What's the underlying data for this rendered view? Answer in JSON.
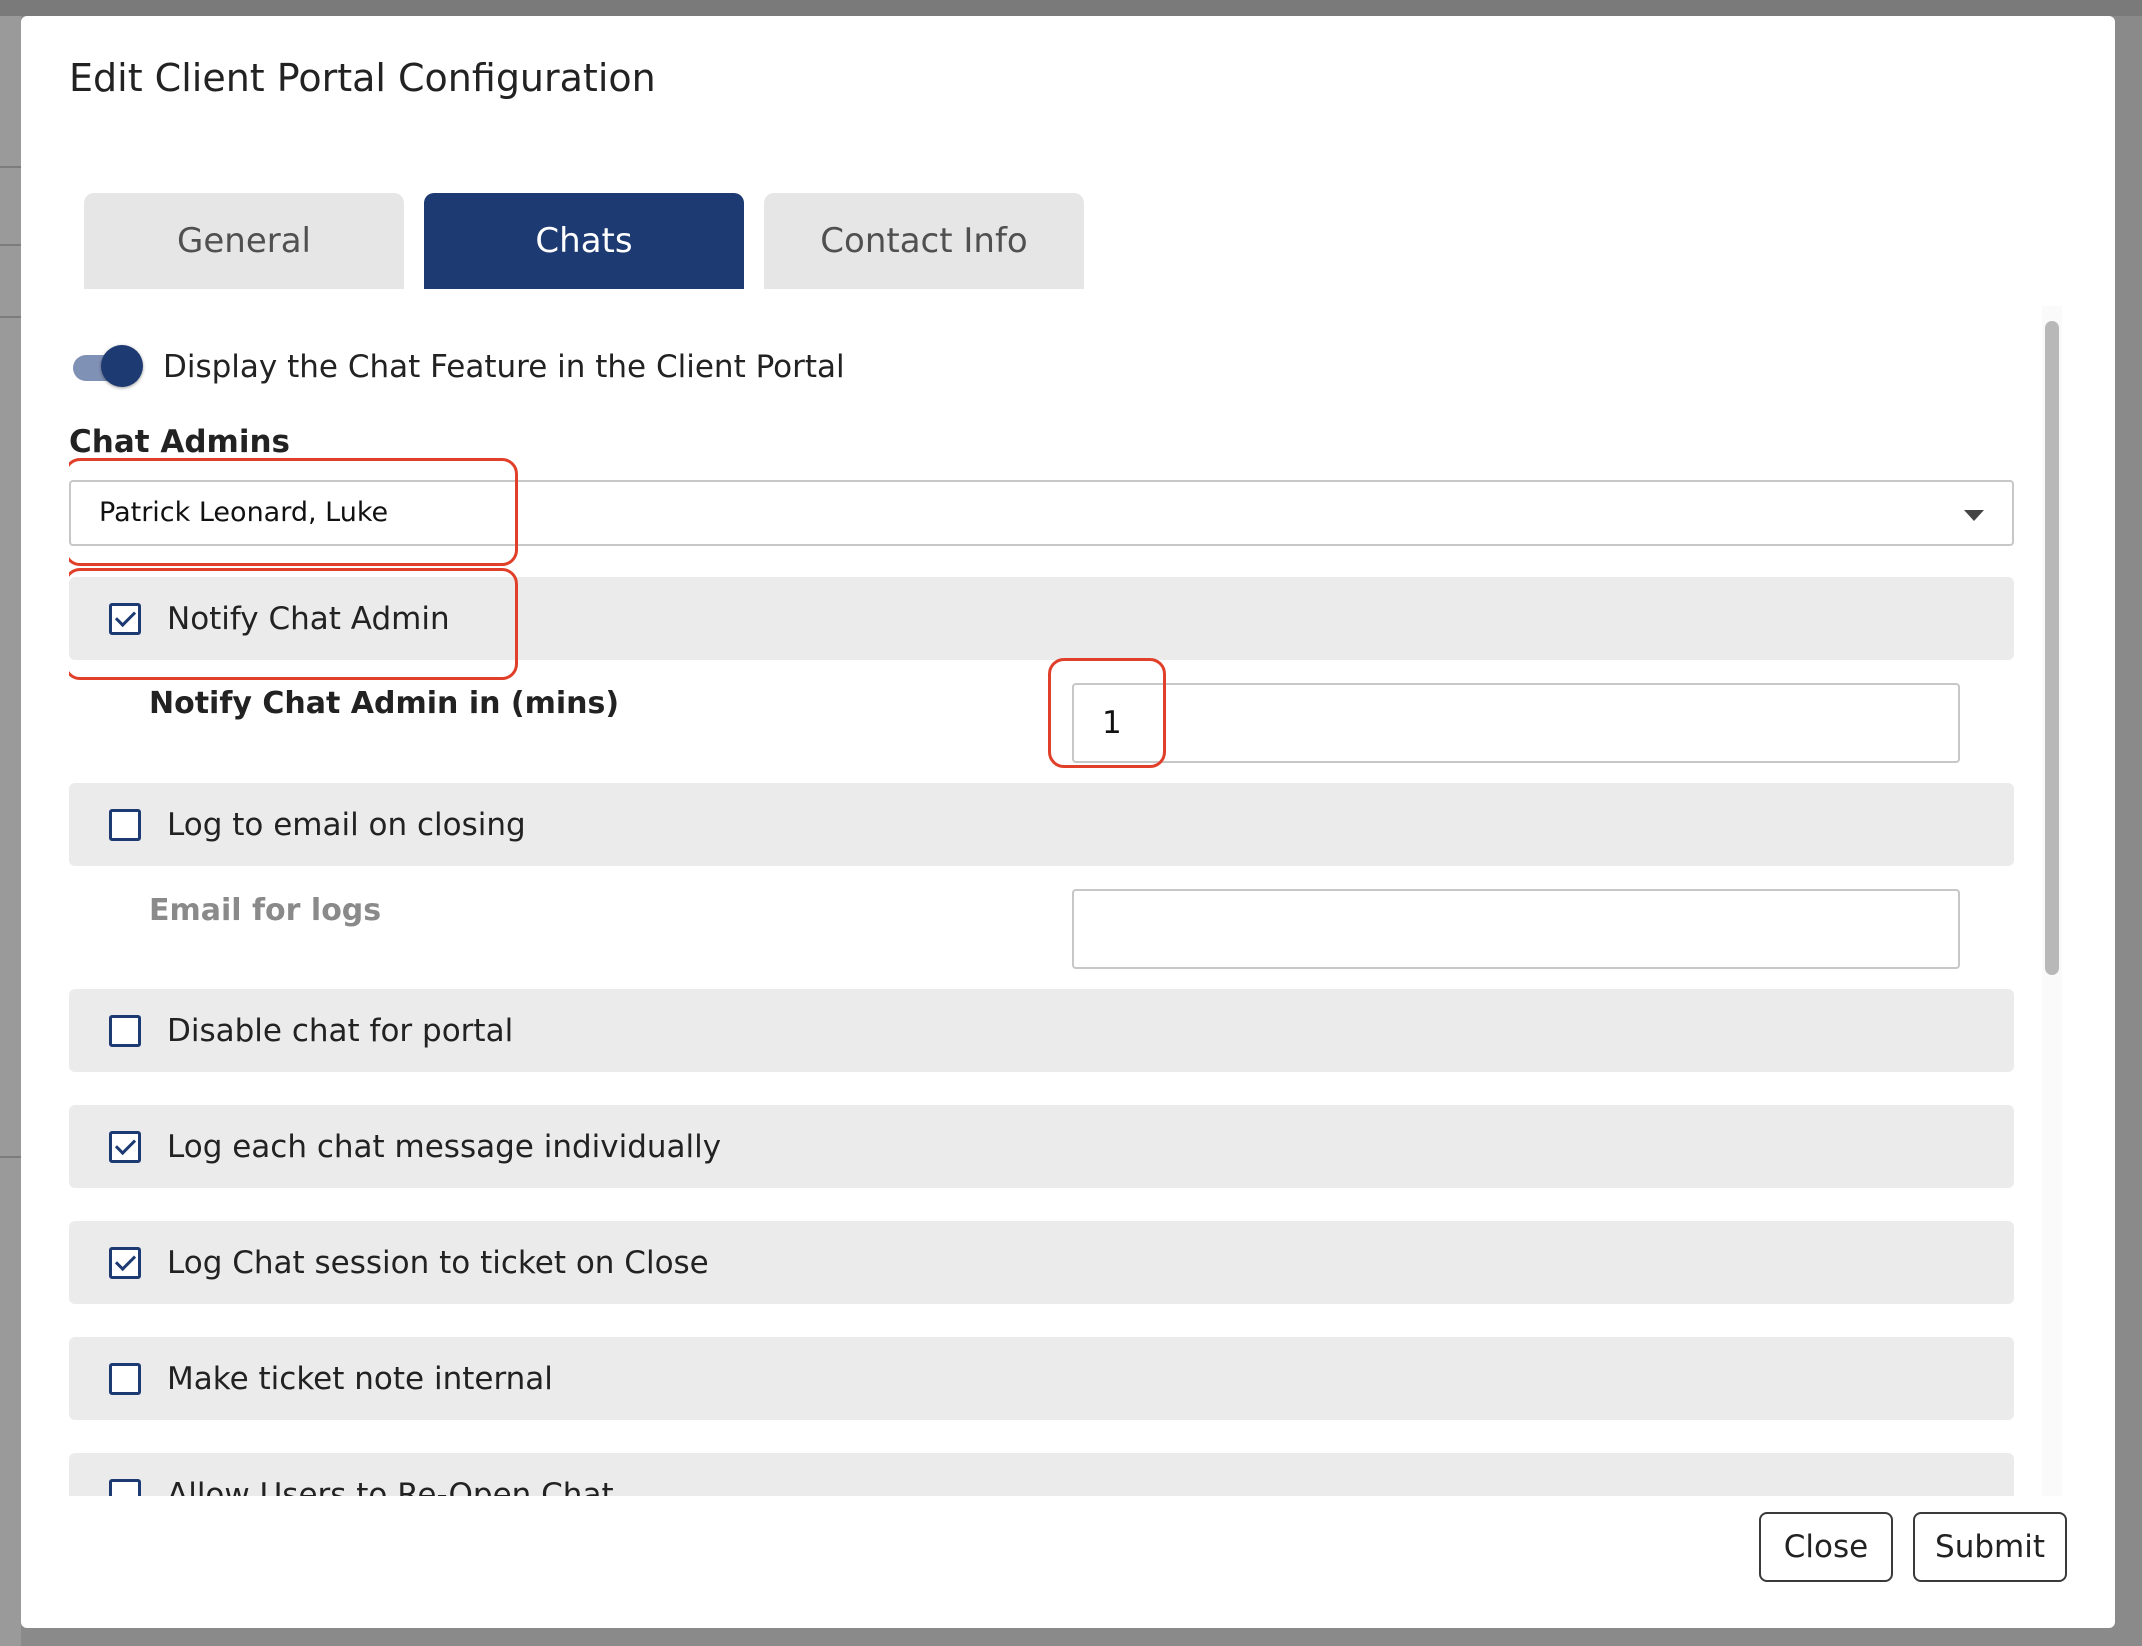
{
  "dialog": {
    "title": "Edit Client Portal Configuration",
    "tabs": [
      {
        "label": "General",
        "active": false
      },
      {
        "label": "Chats",
        "active": true
      },
      {
        "label": "Contact Info",
        "active": false
      }
    ],
    "close_label": "Close",
    "submit_label": "Submit"
  },
  "chats": {
    "display_toggle": {
      "label": "Display the Chat Feature in the Client Portal",
      "on": true
    },
    "chat_admins_label": "Chat Admins",
    "chat_admins_value": "Patrick Leonard, Luke",
    "notify_chat_admin": {
      "label": "Notify Chat Admin",
      "checked": true
    },
    "notify_mins": {
      "label": "Notify Chat Admin in (mins)",
      "value": "1"
    },
    "log_to_email": {
      "label": "Log to email on closing",
      "checked": false
    },
    "email_for_logs": {
      "label": "Email for logs",
      "value": ""
    },
    "disable_chat": {
      "label": "Disable chat for portal",
      "checked": false
    },
    "log_each_message": {
      "label": "Log each chat message individually",
      "checked": true
    },
    "log_session_ticket": {
      "label": "Log Chat session to ticket on Close",
      "checked": true
    },
    "ticket_note_internal": {
      "label": "Make ticket note internal",
      "checked": false
    },
    "allow_reopen": {
      "label": "Allow Users to Re-Open Chat",
      "checked": false
    }
  },
  "colors": {
    "primary": "#1e3a72",
    "highlight": "#e0402a",
    "row_background": "#ebebeb"
  }
}
